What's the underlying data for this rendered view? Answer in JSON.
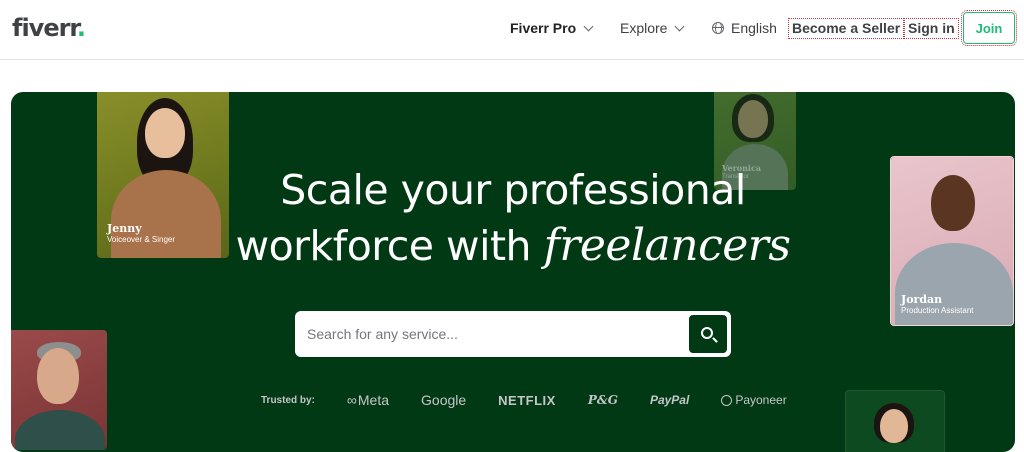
{
  "header": {
    "logo": "fiverr",
    "logo_dot": ".",
    "nav": {
      "fiverr_pro": "Fiverr Pro",
      "explore": "Explore",
      "language": "English",
      "become_seller": "Become a Seller",
      "sign_in": "Sign in",
      "join": "Join"
    }
  },
  "hero": {
    "headline_line1": "Scale your professional",
    "headline_line2_plain": "workforce with ",
    "headline_line2_fancy": "freelancers",
    "search": {
      "placeholder": "Search for any service..."
    },
    "cards": [
      {
        "name": "Jenny",
        "role": "Voiceover & Singer"
      },
      {
        "name": "Veronica",
        "role": "Translator"
      },
      {
        "name": "Jordan",
        "role": "Production Assistant"
      }
    ],
    "trusted": {
      "label": "Trusted by:",
      "brands": [
        "Meta",
        "Google",
        "NETFLIX",
        "P&G",
        "PayPal",
        "Payoneer"
      ]
    }
  },
  "colors": {
    "brand_green": "#1dbf73",
    "hero_bg": "#013914",
    "text_dark": "#404145"
  }
}
